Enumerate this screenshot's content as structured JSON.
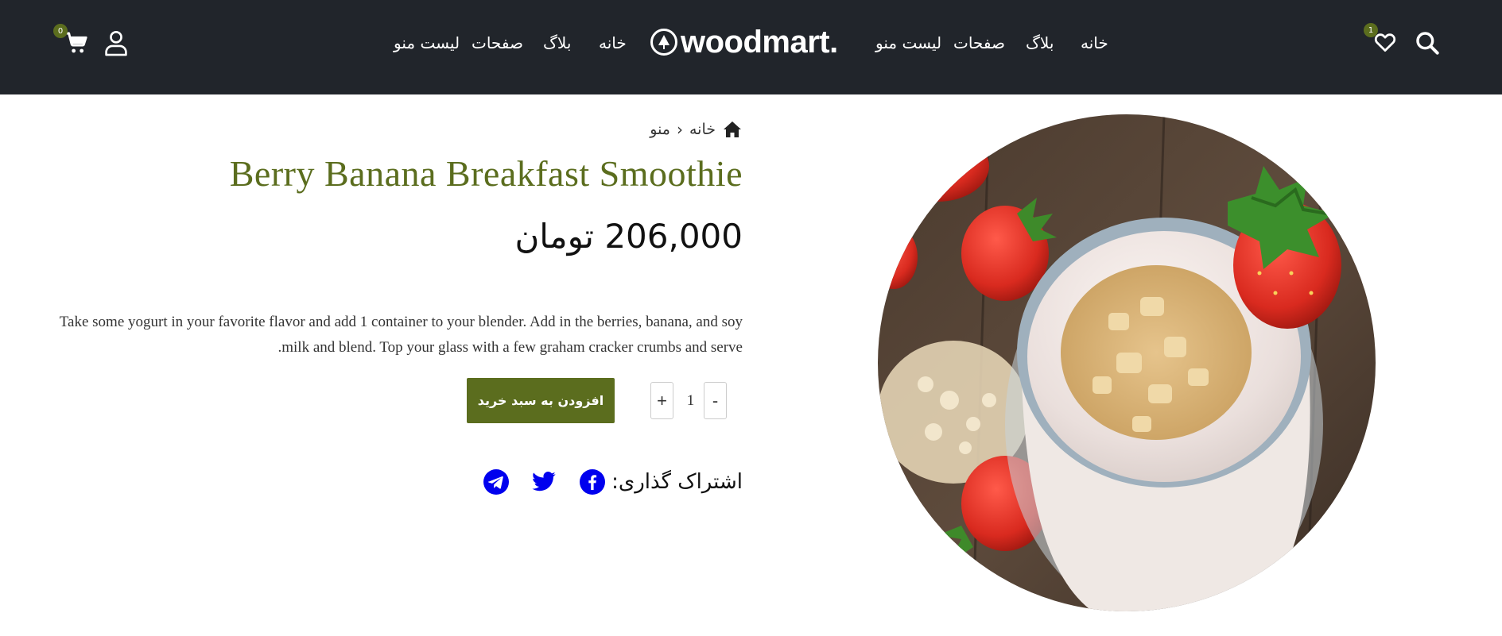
{
  "header": {
    "logo_text": "woodmart.",
    "nav_left": [
      "لیست منو",
      "صفحات",
      "بلاگ",
      "خانه"
    ],
    "nav_right": [
      "لیست منو",
      "صفحات",
      "بلاگ",
      "خانه"
    ],
    "cart_count": "0",
    "wishlist_count": "1",
    "icons": [
      "cart-icon",
      "user-icon",
      "wishlist-icon",
      "search-icon"
    ]
  },
  "breadcrumb": {
    "home": "خانه",
    "current": "منو"
  },
  "product": {
    "title": "Berry Banana Breakfast Smoothie",
    "price": "206,000 تومان",
    "description_line1": "Take some yogurt in your favorite flavor and add 1 container to your blender. Add in the berries, banana, and soy",
    "description_line2": ".milk and blend. Top your glass with a few graham cracker crumbs and serve",
    "quantity": "1",
    "minus": "-",
    "plus": "+",
    "add_to_cart": "افزودن به سبد خرید",
    "share_label": "اشتراک گذاری:"
  },
  "colors": {
    "header_bg": "#21252b",
    "accent": "#5b6d1e",
    "social": "#0000ee"
  }
}
